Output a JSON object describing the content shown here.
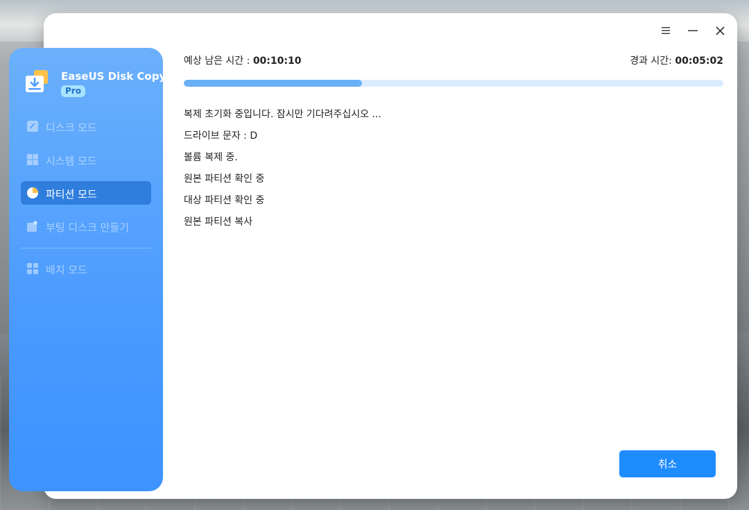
{
  "app": {
    "name": "EaseUS Disk Copy",
    "badge": "Pro"
  },
  "sidebar": {
    "items": [
      {
        "label": "디스크 모드",
        "icon": "disk-icon",
        "active": false
      },
      {
        "label": "시스템 모드",
        "icon": "windows-icon",
        "active": false
      },
      {
        "label": "파티션 모드",
        "icon": "pie-partition-icon",
        "active": true
      },
      {
        "label": "부팅 디스크 만들기",
        "icon": "bootable-disk-icon",
        "active": false
      },
      {
        "label": "배치 모드",
        "icon": "grid-icon",
        "active": false
      }
    ]
  },
  "window_controls": {
    "menu": "menu-icon",
    "minimize": "minimize-icon",
    "close": "close-icon"
  },
  "status": {
    "remaining_label": "예상 남은 시간 : ",
    "remaining_value": "00:10:10",
    "elapsed_label": "경과 시간: ",
    "elapsed_value": "00:05:02",
    "progress_fraction": 0.33
  },
  "log": [
    "복제 초기화 중입니다. 잠시만 기다려주십시오 ...",
    "드라이브 문자 : D",
    "볼륨 복제 중.",
    "원본 파티션 확인 중",
    "대상 파티션 확인 중",
    "원본 파티션 복사"
  ],
  "buttons": {
    "cancel": "취소"
  },
  "colors": {
    "accent": "#1e8bff",
    "sidebar_top": "#6bb0fb",
    "sidebar_bottom": "#3e93ff",
    "progress_fill": "#6aaff8",
    "progress_track": "#dcecff"
  }
}
